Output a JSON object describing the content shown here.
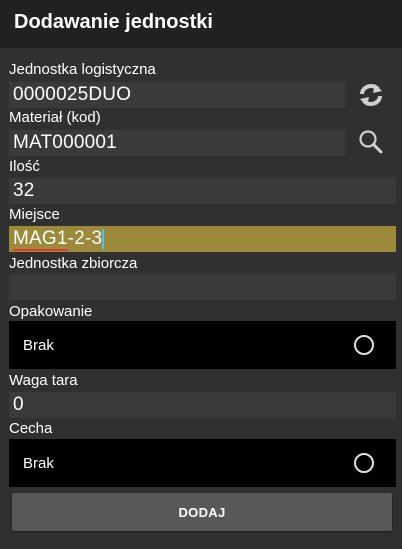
{
  "title": "Dodawanie jednostki",
  "fields": {
    "logistic_unit": {
      "label": "Jednostka logistyczna",
      "value": "0000025DUO"
    },
    "material": {
      "label": "Materiał (kod)",
      "value": "MAT000001"
    },
    "quantity": {
      "label": "Ilość",
      "value": "32"
    },
    "location": {
      "label": "Miejsce",
      "value": "MAG1-2-3"
    },
    "collective_unit": {
      "label": "Jednostka zbiorcza",
      "value": ""
    },
    "packaging": {
      "label": "Opakowanie",
      "value": "Brak"
    },
    "tare_weight": {
      "label": "Waga tara",
      "value": "0"
    },
    "feature": {
      "label": "Cecha",
      "value": "Brak"
    }
  },
  "buttons": {
    "add": "DODAJ"
  },
  "icons": {
    "refresh": "refresh-icon",
    "search": "search-icon"
  },
  "colors": {
    "active_field": "#9c8a3a",
    "background": "#303030",
    "titlebar": "#212121"
  }
}
